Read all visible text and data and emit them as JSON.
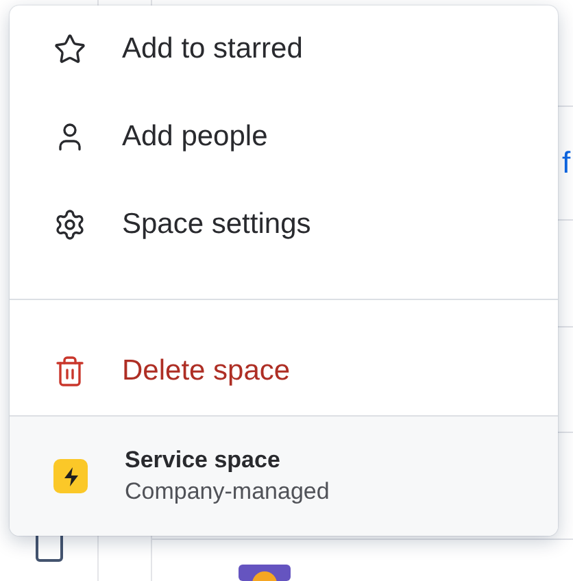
{
  "background_table": {
    "rows": [
      {
        "link": "f"
      },
      {},
      {},
      {}
    ],
    "checkbox": {
      "checked": false
    }
  },
  "menu": {
    "items": [
      {
        "kind": "star",
        "label": "Add to starred"
      },
      {
        "kind": "people",
        "label": "Add people"
      },
      {
        "kind": "settings",
        "label": "Space settings"
      },
      {
        "kind": "divider"
      },
      {
        "kind": "danger",
        "label": "Delete space"
      }
    ],
    "footer": {
      "title": "Service space",
      "subtitle": "Company-managed"
    }
  }
}
